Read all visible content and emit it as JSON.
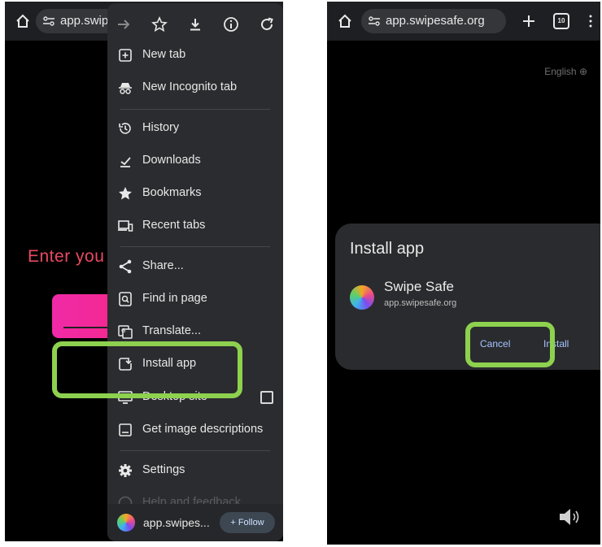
{
  "left_screen": {
    "url_display": "app.swip",
    "page_text": "Enter you",
    "menu": {
      "items": [
        {
          "label": "New tab",
          "icon": "plus-square-icon"
        },
        {
          "label": "New Incognito tab",
          "icon": "incognito-icon"
        },
        {
          "label": "History",
          "icon": "history-icon"
        },
        {
          "label": "Downloads",
          "icon": "download-icon"
        },
        {
          "label": "Bookmarks",
          "icon": "star-icon"
        },
        {
          "label": "Recent tabs",
          "icon": "devices-icon"
        },
        {
          "label": "Share...",
          "icon": "share-icon"
        },
        {
          "label": "Find in page",
          "icon": "find-icon"
        },
        {
          "label": "Translate...",
          "icon": "translate-icon"
        },
        {
          "label": "Install app",
          "icon": "install-icon"
        },
        {
          "label": "Desktop site",
          "icon": "desktop-icon"
        },
        {
          "label": "Get image descriptions",
          "icon": "image-icon"
        },
        {
          "label": "Settings",
          "icon": "gear-icon"
        },
        {
          "label": "Help and feedback",
          "icon": "help-icon"
        }
      ],
      "footer": {
        "site": "app.swipes...",
        "follow_label": "+ Follow"
      }
    }
  },
  "right_screen": {
    "url_display": "app.swipesafe.org",
    "tab_count": "10",
    "language": "English",
    "dialog": {
      "title": "Install app",
      "app_name": "Swipe Safe",
      "app_url": "app.swipesafe.org",
      "cancel_label": "Cancel",
      "install_label": "Install"
    }
  },
  "colors": {
    "highlight": "#8dd14f",
    "accent_pink": "#f02aa8",
    "dialog_link": "#a7c4ff"
  }
}
